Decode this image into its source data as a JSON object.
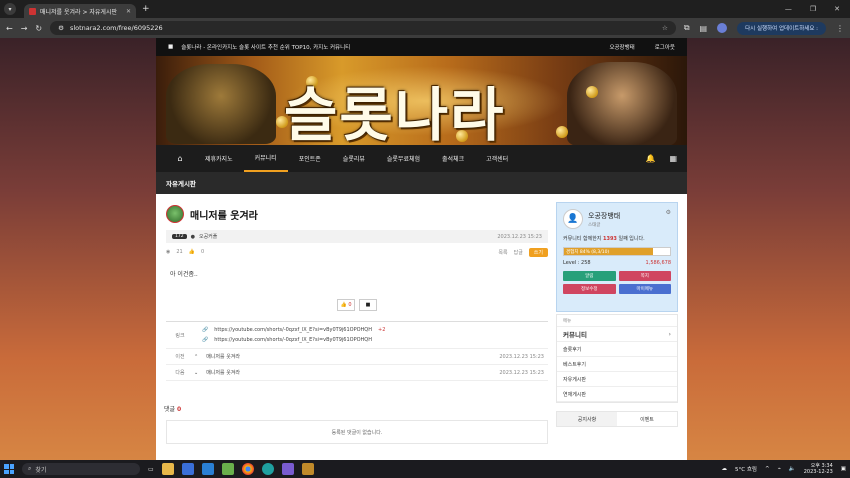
{
  "browser": {
    "tab_title": "매니저를 웃겨라 > 자유게시판",
    "url": "slotnara2.com/free/6095226",
    "update_label": "다시 실행하여 업데이트하세요 :"
  },
  "site": {
    "notice": "슬롯나라 - 온라인카지노 슬롯 사이트 추천 순위 TOP10, 카지노 커뮤니티",
    "top_links": [
      "오공장뱅태",
      "로그아웃"
    ],
    "banner_logo": "슬롯나라",
    "nav_items": [
      "제휴카지노",
      "커뮤니티",
      "포인트존",
      "슬롯리뷰",
      "슬롯무료체험",
      "출석체크",
      "고객센터"
    ],
    "board_title": "자유게시판"
  },
  "post": {
    "title": "매니저를 웃겨라",
    "level": "172",
    "author": "오공커플",
    "date": "2023.12.23 15:23",
    "views": "21",
    "likes": "0",
    "list_label": "목록",
    "reply_label": "답글",
    "write_label": "쓰기",
    "body": "아 이건좀..",
    "like_count": "0"
  },
  "links": {
    "label": "링크",
    "items": [
      "https://youtube.com/shorts/-0qzxf_lX_E?si=vBy0T9j61OPOHQH",
      "https://youtube.com/shorts/-0qzxf_lX_E?si=vBy0T9j61OPOHQH"
    ],
    "count": "+2"
  },
  "prevnext": [
    {
      "label": "이전",
      "title": "매니저를 웃겨라",
      "date": "2023.12.23 15:23"
    },
    {
      "label": "다음",
      "title": "매니저를 웃겨라",
      "date": "2023.12.23 15:23"
    }
  ],
  "comments": {
    "label": "댓글",
    "count": "0",
    "empty": "등록된 댓글이 없습니다."
  },
  "profile": {
    "name": "오공장뱅태",
    "role": "스태글",
    "days_prefix": "커뮤니티 함께한지",
    "days": "1393",
    "days_suffix": "일째 입니다.",
    "exp_label": "경험치 84% (8,3/10)",
    "exp_percent": 84,
    "level_label": "Level : 258",
    "points": "1,586,678",
    "buttons": [
      "알림",
      "쪽지",
      "정보수정",
      "마이메뉴"
    ]
  },
  "side_menu": {
    "small": "메뉴",
    "head": "커뮤니티",
    "items": [
      "슬롯후기",
      "베스트후기",
      "자유게시판",
      "연재게시판"
    ]
  },
  "side_tabs": [
    "공지사항",
    "이벤트"
  ],
  "taskbar": {
    "search": "찾기",
    "weather": "5°C 흐림",
    "time": "오후 3:34",
    "date": "2023-12-23"
  }
}
